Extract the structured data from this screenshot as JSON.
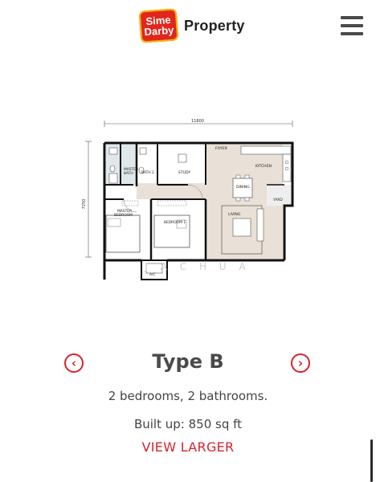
{
  "header": {
    "logo_line1": "Sime",
    "logo_line2": "Darby",
    "logo_word": "Property",
    "menu_icon": "hamburger-icon"
  },
  "floorplan": {
    "dimension_width": "11800",
    "dimension_height": "7250",
    "rooms": {
      "master_bath": "MASTER\nBATH",
      "bath2": "BATH 2",
      "study": "STUDY",
      "foyer": "FOYER",
      "kitchen": "KITCHEN",
      "dining": "DINING",
      "master_bedroom": "MASTER\nBEDROOM",
      "bedroom1": "BEDROOM 1",
      "living": "LIVING",
      "yard": "YARD",
      "ac": "A/C"
    },
    "watermark": "J A   C H U A"
  },
  "unit": {
    "title": "Type B",
    "rooms": "2 bedrooms, 2 bathrooms.",
    "built_up": "Built up: 850 sq ft",
    "view_larger": "VIEW LARGER"
  },
  "nav": {
    "prev_icon": "chevron-left-icon",
    "next_icon": "chevron-right-icon"
  },
  "colors": {
    "brand_red": "#d7232a",
    "living_fill": "#e7ddd4"
  }
}
